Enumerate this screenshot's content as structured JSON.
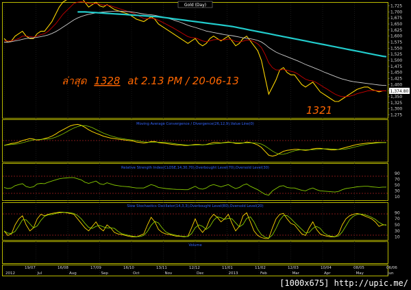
{
  "chart_data": {
    "type": "line",
    "title": "Gold (Day)",
    "annotation": {
      "prefix": "ล่าสุด",
      "value": "1328",
      "suffix": "at 2.13 PM / 20-06-13",
      "low_label": "1321",
      "last_price_box": "1,374.80"
    },
    "price_axis": {
      "ylim": [
        1265,
        1735
      ],
      "ticks": [
        "1,725",
        "1,700",
        "1,675",
        "1,650",
        "1,625",
        "1,600",
        "1,575",
        "1,550",
        "1,525",
        "1,500",
        "1,475",
        "1,450",
        "1,425",
        "1,400",
        "1,375",
        "1,350",
        "1,325",
        "1,300",
        "1,275"
      ]
    },
    "x_axis": {
      "month_labels": [
        "2012",
        "Jul",
        "Aug",
        "Sep",
        "Oct",
        "Nov",
        "Dec",
        "2013",
        "Feb",
        "Mar",
        "Apr",
        "May",
        "Jun"
      ],
      "date_labels": [
        "19/07",
        "16/08",
        "17/09",
        "16/10",
        "13/11",
        "12/12",
        "11/01",
        "11/02",
        "12/03",
        "10/04",
        "08/05",
        "06/06"
      ]
    },
    "series": [
      {
        "name": "Close",
        "color": "#ffd700",
        "values": [
          1590,
          1575,
          1580,
          1600,
          1610,
          1620,
          1600,
          1590,
          1590,
          1610,
          1620,
          1620,
          1640,
          1660,
          1690,
          1720,
          1740,
          1750,
          1770,
          1780,
          1770,
          1760,
          1740,
          1720,
          1730,
          1740,
          1725,
          1720,
          1730,
          1720,
          1710,
          1705,
          1700,
          1695,
          1690,
          1680,
          1670,
          1665,
          1660,
          1670,
          1680,
          1670,
          1650,
          1640,
          1630,
          1620,
          1610,
          1600,
          1590,
          1580,
          1570,
          1580,
          1590,
          1570,
          1560,
          1570,
          1590,
          1600,
          1590,
          1580,
          1590,
          1600,
          1580,
          1560,
          1570,
          1590,
          1600,
          1580,
          1560,
          1540,
          1500,
          1430,
          1360,
          1390,
          1420,
          1460,
          1470,
          1450,
          1440,
          1440,
          1420,
          1400,
          1390,
          1400,
          1410,
          1390,
          1370,
          1360,
          1350,
          1340,
          1330,
          1330,
          1340,
          1350,
          1360,
          1370,
          1380,
          1385,
          1390,
          1390,
          1380,
          1375,
          1370,
          1374,
          1374
        ]
      },
      {
        "name": "EMA short",
        "color": "#cc0000",
        "values": [
          1580,
          1580,
          1580,
          1585,
          1590,
          1600,
          1600,
          1598,
          1596,
          1600,
          1606,
          1610,
          1620,
          1635,
          1650,
          1670,
          1690,
          1705,
          1720,
          1735,
          1740,
          1742,
          1740,
          1735,
          1733,
          1735,
          1732,
          1728,
          1728,
          1725,
          1720,
          1715,
          1710,
          1705,
          1700,
          1695,
          1688,
          1680,
          1673,
          1672,
          1674,
          1672,
          1665,
          1658,
          1650,
          1642,
          1634,
          1625,
          1616,
          1607,
          1598,
          1594,
          1593,
          1587,
          1580,
          1577,
          1580,
          1585,
          1586,
          1584,
          1585,
          1588,
          1585,
          1578,
          1576,
          1579,
          1584,
          1583,
          1577,
          1568,
          1553,
          1525,
          1490,
          1470,
          1460,
          1460,
          1462,
          1459,
          1455,
          1451,
          1443,
          1432,
          1422,
          1417,
          1415,
          1408,
          1399,
          1389,
          1380,
          1370,
          1361,
          1354,
          1350,
          1350,
          1352,
          1356,
          1362,
          1366,
          1370,
          1374,
          1375,
          1375,
          1374,
          1374,
          1374
        ]
      },
      {
        "name": "EMA mid",
        "color": "#cccccc",
        "values": [
          1575,
          1575,
          1577,
          1580,
          1583,
          1587,
          1590,
          1592,
          1593,
          1595,
          1598,
          1601,
          1605,
          1611,
          1618,
          1627,
          1637,
          1647,
          1657,
          1667,
          1675,
          1681,
          1686,
          1690,
          1693,
          1696,
          1698,
          1700,
          1701,
          1702,
          1703,
          1703,
          1703,
          1702,
          1701,
          1699,
          1697,
          1694,
          1691,
          1689,
          1688,
          1686,
          1683,
          1680,
          1676,
          1672,
          1667,
          1662,
          1657,
          1651,
          1645,
          1640,
          1636,
          1631,
          1626,
          1621,
          1618,
          1615,
          1612,
          1609,
          1606,
          1604,
          1602,
          1599,
          1596,
          1593,
          1591,
          1589,
          1586,
          1582,
          1576,
          1566,
          1553,
          1543,
          1534,
          1527,
          1521,
          1515,
          1509,
          1503,
          1497,
          1490,
          1483,
          1477,
          1471,
          1465,
          1459,
          1452,
          1446,
          1440,
          1434,
          1428,
          1423,
          1419,
          1415,
          1412,
          1410,
          1408,
          1406,
          1404,
          1402,
          1400,
          1398,
          1397,
          1396
        ]
      },
      {
        "name": "EMA long",
        "color": "#22cccc",
        "values": [
          null,
          null,
          null,
          null,
          null,
          null,
          null,
          null,
          null,
          null,
          null,
          null,
          null,
          null,
          null,
          null,
          null,
          null,
          null,
          null,
          1700,
          1700,
          1700,
          1699,
          1698,
          1697,
          1696,
          1695,
          1694,
          1693,
          1692,
          1691,
          1690,
          1689,
          1688,
          1687,
          1686,
          1685,
          1684,
          1683,
          1682,
          1681,
          1680,
          1678,
          1676,
          1674,
          1672,
          1670,
          1668,
          1666,
          1664,
          1662,
          1660,
          1658,
          1656,
          1654,
          1652,
          1650,
          1648,
          1646,
          1644,
          1642,
          1640,
          1637,
          1634,
          1631,
          1628,
          1625,
          1622,
          1619,
          1616,
          1613,
          1610,
          1607,
          1604,
          1601,
          1598,
          1595,
          1592,
          1589,
          1586,
          1583,
          1580,
          1577,
          1574,
          1571,
          1568,
          1565,
          1562,
          1559,
          1556,
          1553,
          1550,
          1547,
          1544,
          1541,
          1538,
          1535,
          1532,
          1529,
          1526,
          1523,
          1520,
          1517,
          1515
        ]
      }
    ],
    "panels": [
      {
        "label": "Moving Average Convergence / Divergence(26,12,9),Value Line(0)",
        "ticks": []
      },
      {
        "label": "Relative Strength Index(CLOSE,14,30,70),Overbought Level(70),Oversold Level(30)",
        "ticks": [
          "90",
          "70",
          "50",
          "30",
          "10"
        ]
      },
      {
        "label": "Slow Stochastics Oscillator(14,3,3),Overbought Level(80),Oversold Level(20)",
        "ticks": [
          "90",
          "70",
          "50",
          "30",
          "10"
        ]
      },
      {
        "label": "Volume",
        "ticks": []
      }
    ],
    "macd": [
      -10,
      -8,
      -6,
      -5,
      -3,
      0,
      2,
      4,
      3,
      1,
      2,
      4,
      6,
      9,
      13,
      18,
      22,
      26,
      30,
      32,
      33,
      31,
      27,
      22,
      18,
      15,
      12,
      9,
      7,
      5,
      4,
      3,
      2,
      1,
      0,
      -1,
      -3,
      -4,
      -5,
      -4,
      -2,
      -2,
      -4,
      -5,
      -6,
      -7,
      -8,
      -9,
      -9,
      -10,
      -10,
      -9,
      -8,
      -8,
      -9,
      -8,
      -6,
      -4,
      -4,
      -5,
      -4,
      -3,
      -4,
      -6,
      -6,
      -5,
      -3,
      -4,
      -6,
      -9,
      -14,
      -22,
      -30,
      -32,
      -30,
      -26,
      -22,
      -20,
      -19,
      -18,
      -18,
      -19,
      -20,
      -19,
      -17,
      -16,
      -16,
      -17,
      -18,
      -19,
      -19,
      -18,
      -16,
      -14,
      -12,
      -10,
      -8,
      -7,
      -6,
      -5,
      -5,
      -4,
      -4,
      -4,
      -4
    ],
    "rsi": [
      42,
      38,
      40,
      48,
      52,
      55,
      45,
      42,
      44,
      54,
      56,
      55,
      60,
      64,
      68,
      72,
      74,
      75,
      76,
      76,
      72,
      68,
      60,
      56,
      60,
      64,
      55,
      52,
      58,
      54,
      50,
      48,
      46,
      45,
      44,
      42,
      40,
      40,
      40,
      46,
      52,
      48,
      42,
      40,
      38,
      37,
      36,
      35,
      35,
      34,
      34,
      40,
      46,
      38,
      36,
      40,
      48,
      52,
      48,
      44,
      48,
      52,
      44,
      38,
      42,
      50,
      54,
      46,
      40,
      34,
      26,
      18,
      15,
      30,
      38,
      46,
      48,
      42,
      40,
      40,
      36,
      32,
      30,
      36,
      40,
      34,
      30,
      29,
      28,
      27,
      26,
      28,
      34,
      38,
      40,
      42,
      44,
      45,
      46,
      46,
      44,
      43,
      42,
      43,
      43
    ],
    "stoch_k": [
      30,
      15,
      20,
      50,
      70,
      80,
      50,
      30,
      40,
      70,
      85,
      80,
      85,
      88,
      90,
      92,
      92,
      90,
      88,
      85,
      70,
      55,
      40,
      30,
      45,
      60,
      40,
      30,
      50,
      40,
      25,
      20,
      18,
      15,
      12,
      10,
      10,
      15,
      20,
      50,
      75,
      60,
      35,
      25,
      20,
      18,
      15,
      12,
      12,
      10,
      12,
      40,
      70,
      40,
      25,
      40,
      70,
      85,
      75,
      60,
      70,
      85,
      55,
      30,
      45,
      80,
      90,
      60,
      30,
      15,
      8,
      5,
      5,
      40,
      70,
      85,
      88,
      70,
      55,
      50,
      35,
      20,
      15,
      40,
      60,
      35,
      20,
      15,
      12,
      10,
      10,
      20,
      50,
      70,
      80,
      85,
      88,
      85,
      80,
      75,
      70,
      60,
      45,
      50,
      50
    ]
  },
  "footer_text": "[1000x675] http://upic.me/"
}
